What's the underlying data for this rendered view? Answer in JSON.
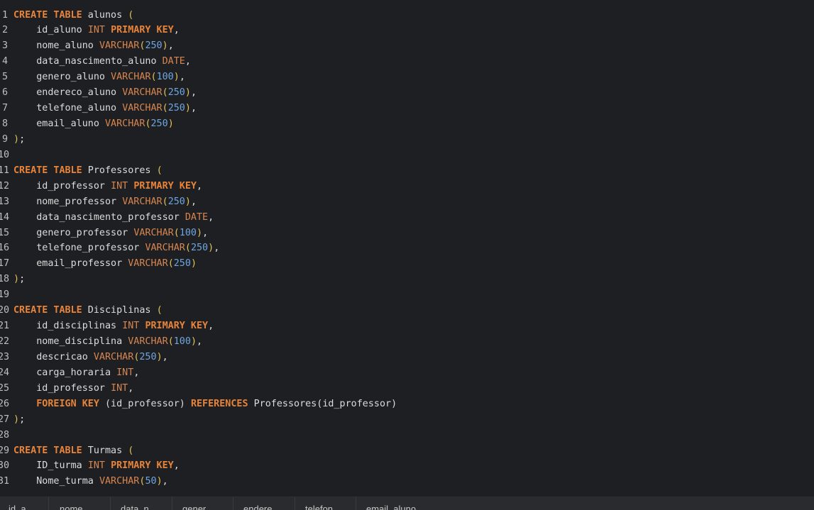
{
  "editor": {
    "lines": [
      {
        "n": "1",
        "tokens": [
          [
            "kw",
            "CREATE TABLE"
          ],
          [
            "id",
            " alunos "
          ],
          [
            "par",
            "("
          ]
        ]
      },
      {
        "n": "2",
        "tokens": [
          [
            "id",
            "    id_aluno "
          ],
          [
            "ty",
            "INT"
          ],
          [
            "id",
            " "
          ],
          [
            "kw",
            "PRIMARY KEY"
          ],
          [
            "id",
            ","
          ]
        ]
      },
      {
        "n": "3",
        "tokens": [
          [
            "id",
            "    nome_aluno "
          ],
          [
            "ty",
            "VARCHAR"
          ],
          [
            "par",
            "("
          ],
          [
            "num",
            "250"
          ],
          [
            "par",
            ")"
          ],
          [
            "id",
            ","
          ]
        ]
      },
      {
        "n": "4",
        "tokens": [
          [
            "id",
            "    data_nascimento_aluno "
          ],
          [
            "ty",
            "DATE"
          ],
          [
            "id",
            ","
          ]
        ]
      },
      {
        "n": "5",
        "tokens": [
          [
            "id",
            "    genero_aluno "
          ],
          [
            "ty",
            "VARCHAR"
          ],
          [
            "par",
            "("
          ],
          [
            "num",
            "100"
          ],
          [
            "par",
            ")"
          ],
          [
            "id",
            ","
          ]
        ]
      },
      {
        "n": "6",
        "tokens": [
          [
            "id",
            "    endereco_aluno "
          ],
          [
            "ty",
            "VARCHAR"
          ],
          [
            "par",
            "("
          ],
          [
            "num",
            "250"
          ],
          [
            "par",
            ")"
          ],
          [
            "id",
            ","
          ]
        ]
      },
      {
        "n": "7",
        "tokens": [
          [
            "id",
            "    telefone_aluno "
          ],
          [
            "ty",
            "VARCHAR"
          ],
          [
            "par",
            "("
          ],
          [
            "num",
            "250"
          ],
          [
            "par",
            ")"
          ],
          [
            "id",
            ","
          ]
        ]
      },
      {
        "n": "8",
        "tokens": [
          [
            "id",
            "    email_aluno "
          ],
          [
            "ty",
            "VARCHAR"
          ],
          [
            "par",
            "("
          ],
          [
            "num",
            "250"
          ],
          [
            "par",
            ")"
          ]
        ]
      },
      {
        "n": "9",
        "tokens": [
          [
            "par",
            ")"
          ],
          [
            "id",
            ";"
          ]
        ]
      },
      {
        "n": "10",
        "tokens": []
      },
      {
        "n": "11",
        "tokens": [
          [
            "kw",
            "CREATE TABLE"
          ],
          [
            "id",
            " Professores "
          ],
          [
            "par",
            "("
          ]
        ]
      },
      {
        "n": "12",
        "tokens": [
          [
            "id",
            "    id_professor "
          ],
          [
            "ty",
            "INT"
          ],
          [
            "id",
            " "
          ],
          [
            "kw",
            "PRIMARY KEY"
          ],
          [
            "id",
            ","
          ]
        ]
      },
      {
        "n": "13",
        "tokens": [
          [
            "id",
            "    nome_professor "
          ],
          [
            "ty",
            "VARCHAR"
          ],
          [
            "par",
            "("
          ],
          [
            "num",
            "250"
          ],
          [
            "par",
            ")"
          ],
          [
            "id",
            ","
          ]
        ]
      },
      {
        "n": "14",
        "tokens": [
          [
            "id",
            "    data_nascimento_professor "
          ],
          [
            "ty",
            "DATE"
          ],
          [
            "id",
            ","
          ]
        ]
      },
      {
        "n": "15",
        "tokens": [
          [
            "id",
            "    genero_professor "
          ],
          [
            "ty",
            "VARCHAR"
          ],
          [
            "par",
            "("
          ],
          [
            "num",
            "100"
          ],
          [
            "par",
            ")"
          ],
          [
            "id",
            ","
          ]
        ]
      },
      {
        "n": "16",
        "tokens": [
          [
            "id",
            "    telefone_professor "
          ],
          [
            "ty",
            "VARCHAR"
          ],
          [
            "par",
            "("
          ],
          [
            "num",
            "250"
          ],
          [
            "par",
            ")"
          ],
          [
            "id",
            ","
          ]
        ]
      },
      {
        "n": "17",
        "tokens": [
          [
            "id",
            "    email_professor "
          ],
          [
            "ty",
            "VARCHAR"
          ],
          [
            "par",
            "("
          ],
          [
            "num",
            "250"
          ],
          [
            "par",
            ")"
          ]
        ]
      },
      {
        "n": "18",
        "tokens": [
          [
            "par",
            ")"
          ],
          [
            "id",
            ";"
          ]
        ]
      },
      {
        "n": "19",
        "tokens": []
      },
      {
        "n": "20",
        "tokens": [
          [
            "kw",
            "CREATE TABLE"
          ],
          [
            "id",
            " Disciplinas "
          ],
          [
            "par",
            "("
          ]
        ]
      },
      {
        "n": "21",
        "tokens": [
          [
            "id",
            "    id_disciplinas "
          ],
          [
            "ty",
            "INT"
          ],
          [
            "id",
            " "
          ],
          [
            "kw",
            "PRIMARY KEY"
          ],
          [
            "id",
            ","
          ]
        ]
      },
      {
        "n": "22",
        "tokens": [
          [
            "id",
            "    nome_disciplina "
          ],
          [
            "ty",
            "VARCHAR"
          ],
          [
            "par",
            "("
          ],
          [
            "num",
            "100"
          ],
          [
            "par",
            ")"
          ],
          [
            "id",
            ","
          ]
        ]
      },
      {
        "n": "23",
        "tokens": [
          [
            "id",
            "    descricao "
          ],
          [
            "ty",
            "VARCHAR"
          ],
          [
            "par",
            "("
          ],
          [
            "num",
            "250"
          ],
          [
            "par",
            ")"
          ],
          [
            "id",
            ","
          ]
        ]
      },
      {
        "n": "24",
        "tokens": [
          [
            "id",
            "    carga_horaria "
          ],
          [
            "ty",
            "INT"
          ],
          [
            "id",
            ","
          ]
        ]
      },
      {
        "n": "25",
        "tokens": [
          [
            "id",
            "    id_professor "
          ],
          [
            "ty",
            "INT"
          ],
          [
            "id",
            ","
          ]
        ]
      },
      {
        "n": "26",
        "tokens": [
          [
            "id",
            "    "
          ],
          [
            "kw",
            "FOREIGN KEY"
          ],
          [
            "id",
            " (id_professor) "
          ],
          [
            "kw",
            "REFERENCES"
          ],
          [
            "id",
            " Professores(id_professor)"
          ]
        ]
      },
      {
        "n": "27",
        "tokens": [
          [
            "par",
            ")"
          ],
          [
            "id",
            ";"
          ]
        ]
      },
      {
        "n": "28",
        "tokens": []
      },
      {
        "n": "29",
        "tokens": [
          [
            "kw",
            "CREATE TABLE"
          ],
          [
            "id",
            " Turmas "
          ],
          [
            "par",
            "("
          ]
        ]
      },
      {
        "n": "30",
        "tokens": [
          [
            "id",
            "    ID_turma "
          ],
          [
            "ty",
            "INT"
          ],
          [
            "id",
            " "
          ],
          [
            "kw",
            "PRIMARY KEY"
          ],
          [
            "id",
            ","
          ]
        ]
      },
      {
        "n": "31",
        "tokens": [
          [
            "id",
            "    Nome_turma "
          ],
          [
            "ty",
            "VARCHAR"
          ],
          [
            "par",
            "("
          ],
          [
            "num",
            "50"
          ],
          [
            "par",
            ")"
          ],
          [
            "id",
            ","
          ]
        ]
      }
    ]
  },
  "results": {
    "columns": [
      "id_a...",
      "nome_...",
      "data_n...",
      "gener...",
      "endere...",
      "telefon...",
      "email_aluno"
    ]
  },
  "colors": {
    "background": "#1e1f22",
    "keyword": "#e8843a",
    "type": "#d88650",
    "number": "#6fa6e0",
    "paren": "#e0c25a",
    "identifier": "#dcdcdc"
  }
}
